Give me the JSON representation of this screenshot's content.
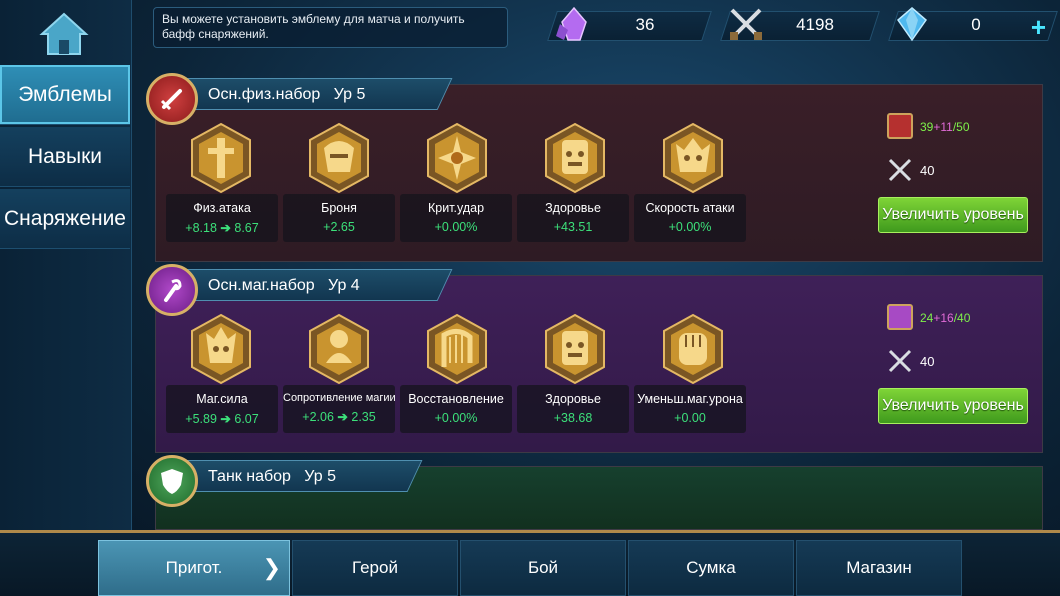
{
  "notice": "Вы можете установить эмблему для матча и получить бафф снаряжений.",
  "resources": {
    "magic_dust": "36",
    "battle_points": "4198",
    "diamonds": "0"
  },
  "sidebar": {
    "items": [
      {
        "label": "Эмблемы"
      },
      {
        "label": "Навыки"
      },
      {
        "label": "Снаряжение"
      }
    ]
  },
  "sets": [
    {
      "name": "Осн.физ.набор",
      "level": "Ур 5",
      "fragments": {
        "cur": "39",
        "add": "+11",
        "max": "/50"
      },
      "battle_points": "40",
      "upgrade_label": "Увеличить уровень",
      "stats": [
        {
          "name": "Физ.атака",
          "value": "+8.18",
          "next": "8.67"
        },
        {
          "name": "Броня",
          "value": "+2.65",
          "next": ""
        },
        {
          "name": "Крит.удар",
          "value": "+0.00%",
          "next": ""
        },
        {
          "name": "Здоровье",
          "value": "+43.51",
          "next": ""
        },
        {
          "name": "Скорость атаки",
          "value": "+0.00%",
          "next": ""
        }
      ]
    },
    {
      "name": "Осн.маг.набор",
      "level": "Ур 4",
      "fragments": {
        "cur": "24",
        "add": "+16",
        "max": "/40"
      },
      "battle_points": "40",
      "upgrade_label": "Увеличить уровень",
      "stats": [
        {
          "name": "Маг.сила",
          "value": "+5.89",
          "next": "6.07"
        },
        {
          "name": "Сопротивление магии",
          "value": "+2.06",
          "next": "2.35"
        },
        {
          "name": "Восстановление",
          "value": "+0.00%",
          "next": ""
        },
        {
          "name": "Здоровье",
          "value": "+38.68",
          "next": ""
        },
        {
          "name": "Уменьш.маг.урона",
          "value": "+0.00",
          "next": ""
        }
      ]
    },
    {
      "name": "Танк набор",
      "level": "Ур 5"
    }
  ],
  "bottom_nav": [
    {
      "label": "Пригот."
    },
    {
      "label": "Герой"
    },
    {
      "label": "Бой"
    },
    {
      "label": "Сумка"
    },
    {
      "label": "Магазин"
    }
  ],
  "colors": {
    "accent_green": "#3ce07a",
    "button_green": "#5cb82a",
    "gold": "#d7b066"
  }
}
